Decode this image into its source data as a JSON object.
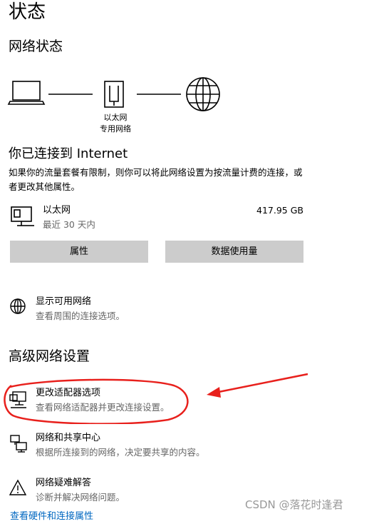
{
  "page": {
    "title": "状态"
  },
  "network_status": {
    "title": "网络状态",
    "adapter_label_line1": "以太网",
    "adapter_label_line2": "专用网络"
  },
  "connection": {
    "title": "你已连接到 Internet",
    "description": "如果你的流量套餐有限制，则你可以将此网络设置为按流量计费的连接，或者更改其他属性。"
  },
  "ethernet": {
    "name": "以太网",
    "period": "最近 30 天内",
    "usage": "417.95 GB"
  },
  "buttons": {
    "properties": "属性",
    "data_usage": "数据使用量"
  },
  "show_networks": {
    "title": "显示可用网络",
    "desc": "查看周围的连接选项。"
  },
  "advanced": {
    "title": "高级网络设置",
    "items": [
      {
        "title": "更改适配器选项",
        "desc": "查看网络适配器并更改连接设置。",
        "icon": "monitor-adapter-icon"
      },
      {
        "title": "网络和共享中心",
        "desc": "根据所连接到的网络，决定要共享的内容。",
        "icon": "sharing-center-icon"
      },
      {
        "title": "网络疑难解答",
        "desc": "诊断并解决网络问题。",
        "icon": "warning-triangle-icon"
      }
    ],
    "cut_link": "查看硬件和连接属性"
  },
  "watermark": "CSDN @落花时逢君",
  "annotation": {
    "color": "#e8201c"
  }
}
